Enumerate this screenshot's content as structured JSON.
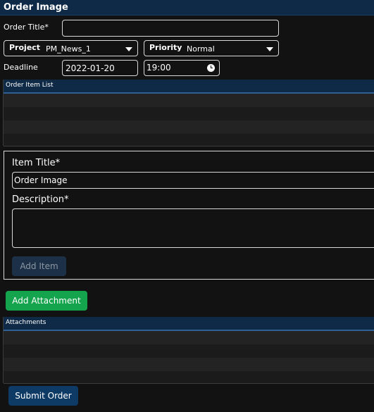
{
  "window": {
    "title": "Order Image"
  },
  "order": {
    "title_label": "Order Title*",
    "title_value": "",
    "project": {
      "label": "Project",
      "value": "PM_News_1"
    },
    "priority": {
      "label": "Priority",
      "value": "Normal"
    },
    "deadline": {
      "label": "Deadline",
      "date": "2022-01-20",
      "time": "19:00"
    }
  },
  "order_item_list": {
    "header": "Order Item List",
    "rows": [
      "",
      "",
      "",
      ""
    ]
  },
  "item_form": {
    "item_title_label": "Item Title*",
    "item_title_value": "Order Image",
    "description_label": "Description*",
    "description_value": "",
    "add_item_label": "Add Item"
  },
  "add_attachment_label": "Add Attachment",
  "attachments": {
    "header": "Attachments",
    "rows": [
      "",
      "",
      "",
      ""
    ]
  },
  "submit_label": "Submit Order",
  "icons": {
    "clock": "clock-icon",
    "dropdown": "chevron-down-icon"
  }
}
